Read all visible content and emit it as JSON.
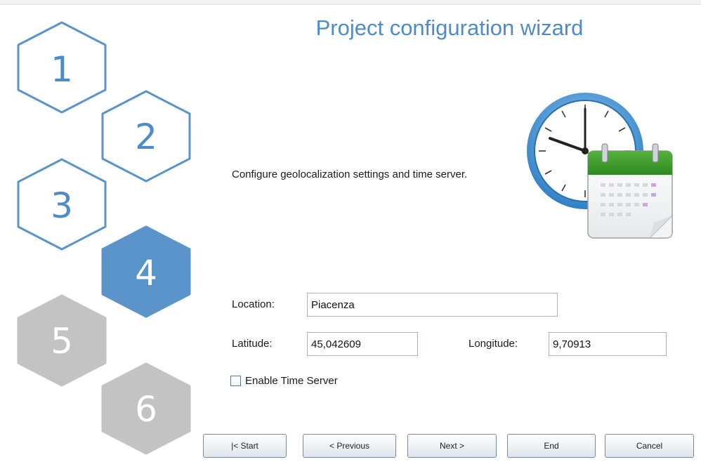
{
  "wizard": {
    "title": "Project configuration wizard",
    "description": "Configure geolocalization settings and time server.",
    "illustration_icon": "clock-calendar-icon"
  },
  "steps": [
    {
      "label": "1",
      "state": "done"
    },
    {
      "label": "2",
      "state": "done"
    },
    {
      "label": "3",
      "state": "done"
    },
    {
      "label": "4",
      "state": "current"
    },
    {
      "label": "5",
      "state": "pending"
    },
    {
      "label": "6",
      "state": "pending"
    }
  ],
  "form": {
    "location_label": "Location:",
    "location_value": "Piacenza",
    "latitude_label": "Latitude:",
    "latitude_value": "45,042609",
    "longitude_label": "Longitude:",
    "longitude_value": "9,70913",
    "time_server_label": "Enable Time Server",
    "time_server_checked": false
  },
  "buttons": {
    "start": "|< Start",
    "previous": "< Previous",
    "next": "Next >",
    "end": "End",
    "cancel": "Cancel"
  },
  "colors": {
    "accent": "#4e8bc9",
    "current_step": "#5b93cb",
    "pending_step": "#c3c3c3",
    "calendar_green": "#3f9b2a"
  }
}
